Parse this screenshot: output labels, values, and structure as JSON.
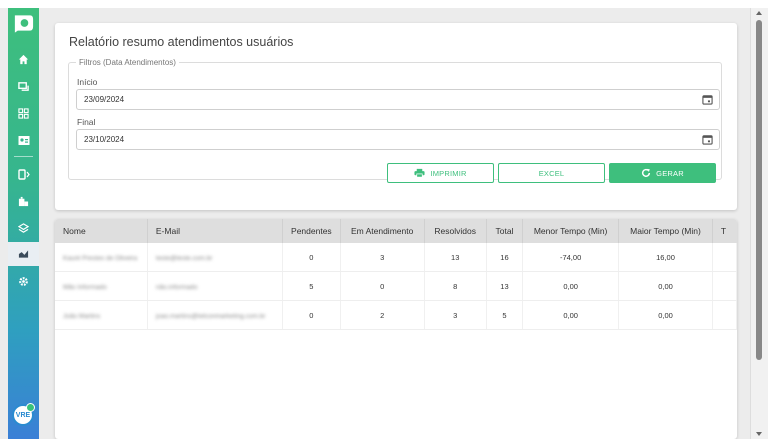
{
  "page": {
    "title": "Relatório resumo atendimentos usuários"
  },
  "filters": {
    "legend": "Filtros (Data Atendimentos)",
    "start_label": "Início",
    "start_value": "23/09/2024",
    "end_label": "Final",
    "end_value": "23/10/2024"
  },
  "actions": {
    "print_label": "IMPRIMIR",
    "excel_label": "EXCEL",
    "generate_label": "GERAR"
  },
  "sidebar": {
    "avatar_text": "VRE",
    "items": [
      {
        "icon": "home-icon"
      },
      {
        "icon": "chat-icon"
      },
      {
        "icon": "dashboard-icon"
      },
      {
        "icon": "contact-card-icon"
      },
      {
        "icon": "phone-transfer-icon"
      },
      {
        "icon": "building-icon"
      },
      {
        "icon": "layers-icon"
      },
      {
        "icon": "chart-icon",
        "active": true
      },
      {
        "icon": "gear-icon"
      }
    ]
  },
  "table": {
    "columns": [
      "Nome",
      "E-Mail",
      "Pendentes",
      "Em Atendimento",
      "Resolvidos",
      "Total",
      "Menor Tempo (Min)",
      "Maior Tempo (Min)",
      "T"
    ],
    "rows": [
      {
        "nome": "Kauré Prestes de Oliveira",
        "email": "teste@teste.com.br",
        "pendentes": "0",
        "em_atendimento": "3",
        "resolvidos": "13",
        "total": "16",
        "menor": "-74,00",
        "maior": "16,00"
      },
      {
        "nome": "Mão Informado",
        "email": "não.informado",
        "pendentes": "5",
        "em_atendimento": "0",
        "resolvidos": "8",
        "total": "13",
        "menor": "0,00",
        "maior": "0,00"
      },
      {
        "nome": "João Martins",
        "email": "joao.martins@telconmarketing.com.br",
        "pendentes": "0",
        "em_atendimento": "2",
        "resolvidos": "3",
        "total": "5",
        "menor": "0,00",
        "maior": "0,00"
      }
    ]
  },
  "colors": {
    "accent": "#3ebf7d",
    "sidebar_bottom": "#3a7fd6"
  }
}
